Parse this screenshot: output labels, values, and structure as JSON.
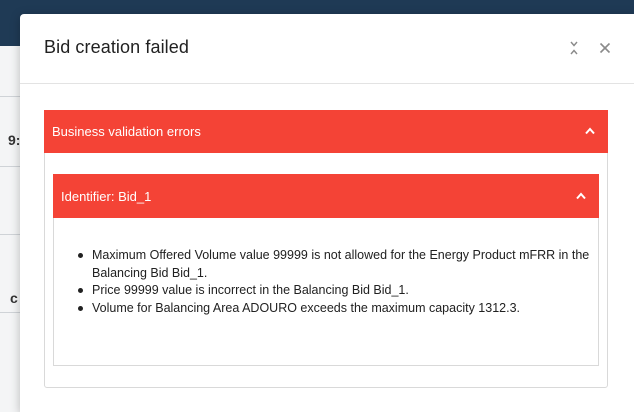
{
  "background": {
    "fragments": [
      "9:",
      "c"
    ]
  },
  "dialog": {
    "title": "Bid creation failed",
    "collapse_icon": "collapse-arrows-icon",
    "close_icon": "close-icon"
  },
  "validation": {
    "header": "Business validation errors",
    "bid": {
      "header": "Identifier: Bid_1",
      "errors": [
        "Maximum Offered Volume value 99999 is not allowed for the Energy Product mFRR in the Balancing Bid Bid_1.",
        "Price 99999 value is incorrect in the Balancing Bid Bid_1.",
        "Volume for Balancing Area ADOURO exceeds the maximum capacity 1312.3."
      ]
    }
  },
  "colors": {
    "error_header": "#f44336",
    "topbar": "#1f3a55"
  }
}
